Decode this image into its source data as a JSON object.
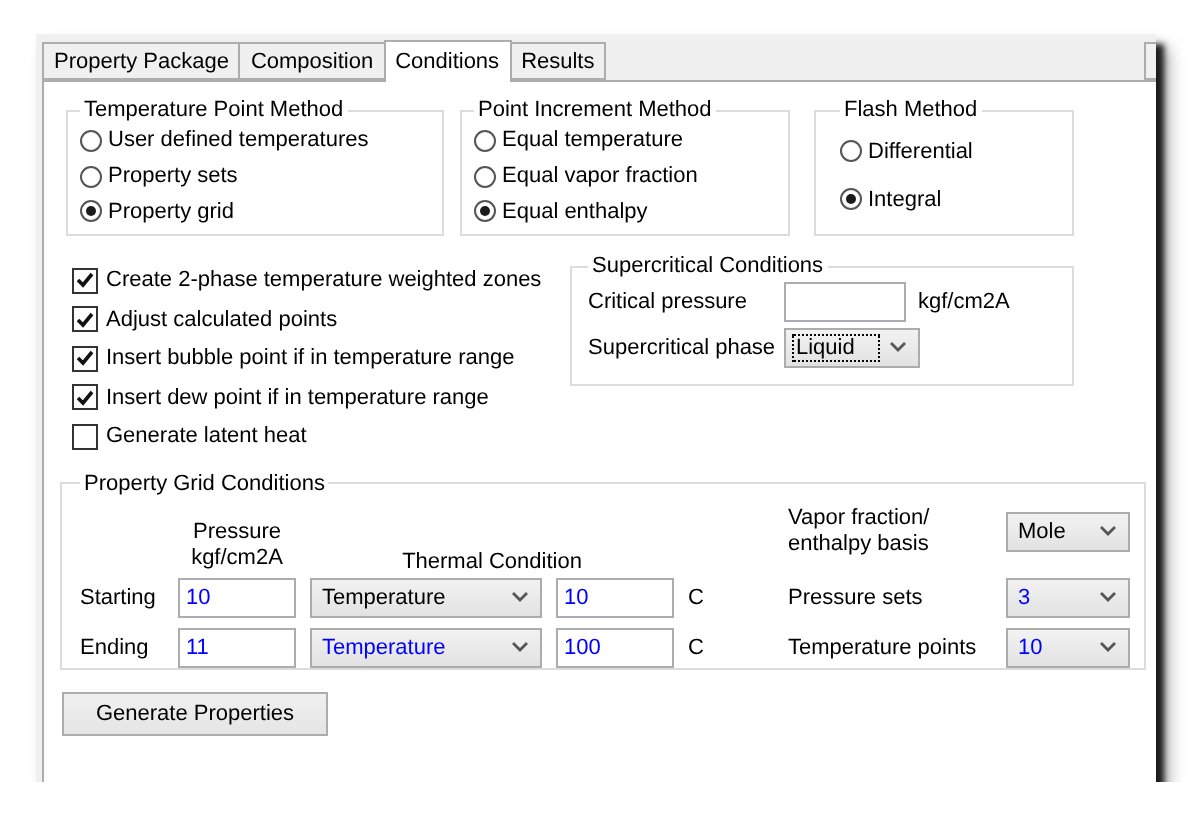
{
  "tabs": [
    {
      "label": "Property Package",
      "selected": false
    },
    {
      "label": "Composition",
      "selected": false
    },
    {
      "label": "Conditions",
      "selected": true
    },
    {
      "label": "Results",
      "selected": false
    }
  ],
  "temperature_point_method": {
    "title": "Temperature Point Method",
    "options": [
      {
        "label": "User defined temperatures",
        "selected": false
      },
      {
        "label": "Property sets",
        "selected": false
      },
      {
        "label": "Property grid",
        "selected": true
      }
    ]
  },
  "point_increment_method": {
    "title": "Point Increment Method",
    "options": [
      {
        "label": "Equal temperature",
        "selected": false
      },
      {
        "label": "Equal vapor fraction",
        "selected": false
      },
      {
        "label": "Equal enthalpy",
        "selected": true
      }
    ]
  },
  "flash_method": {
    "title": "Flash Method",
    "options": [
      {
        "label": "Differential",
        "selected": false
      },
      {
        "label": "Integral",
        "selected": true
      }
    ]
  },
  "options": [
    {
      "label": "Create 2-phase temperature weighted zones",
      "checked": true
    },
    {
      "label": "Adjust calculated points",
      "checked": true
    },
    {
      "label": "Insert bubble point if in temperature range",
      "checked": true
    },
    {
      "label": "Insert dew point if in temperature range",
      "checked": true
    },
    {
      "label": "Generate latent heat",
      "checked": false
    }
  ],
  "supercritical_conditions": {
    "title": "Supercritical Conditions",
    "critical_pressure": {
      "label": "Critical pressure",
      "unit": "kgf/cm2A"
    },
    "supercritical_phase": {
      "label": "Supercritical phase",
      "value": "Liquid",
      "color": "#000000",
      "focused": true
    }
  },
  "property_grid_conditions": {
    "title": "Property Grid Conditions",
    "pressure_header": "Pressure",
    "pressure_unit": "kgf/cm2A",
    "thermal_header": "Thermal Condition",
    "rows": [
      {
        "label": "Starting",
        "pressure": {
          "value": "10",
          "color": "#0000ff"
        },
        "thermal_type": {
          "value": "Temperature",
          "color": "#000000"
        },
        "thermal_value": {
          "value": "10",
          "color": "#0000ff"
        },
        "unit": "C"
      },
      {
        "label": "Ending",
        "pressure": {
          "value": "11",
          "color": "#0000ff"
        },
        "thermal_type": {
          "value": "Temperature",
          "color": "#0000ff"
        },
        "thermal_value": {
          "value": "100",
          "color": "#0000ff"
        },
        "unit": "C"
      }
    ],
    "settings": [
      {
        "label": "Vapor fraction/ enthalpy basis",
        "value": "Mole",
        "color": "#000000"
      },
      {
        "label": "Pressure sets",
        "value": "3",
        "color": "#0000ff"
      },
      {
        "label": "Temperature points",
        "value": "10",
        "color": "#0000ff"
      }
    ]
  },
  "generate_button": "Generate Properties"
}
